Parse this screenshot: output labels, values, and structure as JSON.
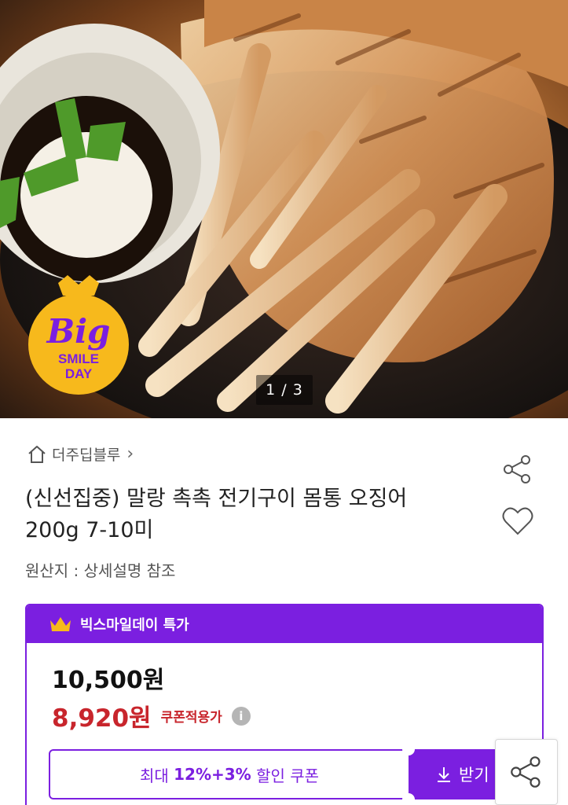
{
  "gallery": {
    "counter": "1 / 3"
  },
  "badge": {
    "line1": "Big",
    "line2": "SMILE",
    "line3": "DAY"
  },
  "seller": {
    "name": "더주딥블루",
    "chevron": "›",
    "icon": "home-icon"
  },
  "product": {
    "title_line1": "(신선집중) 말랑 촉촉 전기구이 몸통 오징어",
    "title_line2": "200g 7-10미",
    "origin": "원산지 : 상세설명 참조"
  },
  "actions": {
    "share_icon": "share-icon",
    "wish_icon": "heart-icon"
  },
  "promo": {
    "header": "빅스마일데이 특가",
    "original_price": "10,500원",
    "sale_price": "8,920원",
    "sale_label": "쿠폰적용가",
    "info": "i",
    "coupon_pre": "최대 ",
    "coupon_bold": "12%+3%",
    "coupon_post": " 할인 쿠폰",
    "coupon_button": "받기"
  },
  "colors": {
    "accent": "#7b1fe0",
    "sale": "#c8252c",
    "badge_yellow": "#f7b91c"
  }
}
